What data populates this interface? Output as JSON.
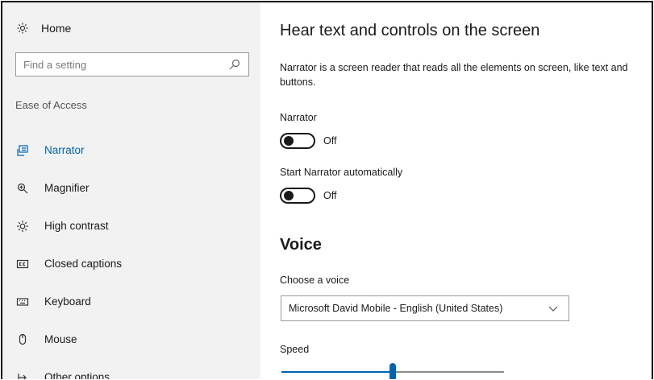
{
  "sidebar": {
    "home_label": "Home",
    "search_placeholder": "Find a setting",
    "section_title": "Ease of Access",
    "items": [
      {
        "label": "Narrator",
        "icon": "narrator-icon",
        "active": true
      },
      {
        "label": "Magnifier",
        "icon": "magnifier-icon",
        "active": false
      },
      {
        "label": "High contrast",
        "icon": "high-contrast-icon",
        "active": false
      },
      {
        "label": "Closed captions",
        "icon": "closed-captions-icon",
        "active": false
      },
      {
        "label": "Keyboard",
        "icon": "keyboard-icon",
        "active": false
      },
      {
        "label": "Mouse",
        "icon": "mouse-icon",
        "active": false
      },
      {
        "label": "Other options",
        "icon": "other-options-icon",
        "active": false
      }
    ]
  },
  "main": {
    "title": "Hear text and controls on the screen",
    "description": "Narrator is a screen reader that reads all the elements on screen, like text and buttons.",
    "narrator": {
      "label": "Narrator",
      "state": "Off"
    },
    "start_auto": {
      "label": "Start Narrator automatically",
      "state": "Off"
    },
    "voice_heading": "Voice",
    "choose_voice_label": "Choose a voice",
    "voice_selected": "Microsoft David Mobile - English (United States)",
    "speed_label": "Speed",
    "speed_value_fraction": 0.5
  },
  "colors": {
    "accent": "#0063b1",
    "sidebar_bg": "#f2f2f2"
  }
}
